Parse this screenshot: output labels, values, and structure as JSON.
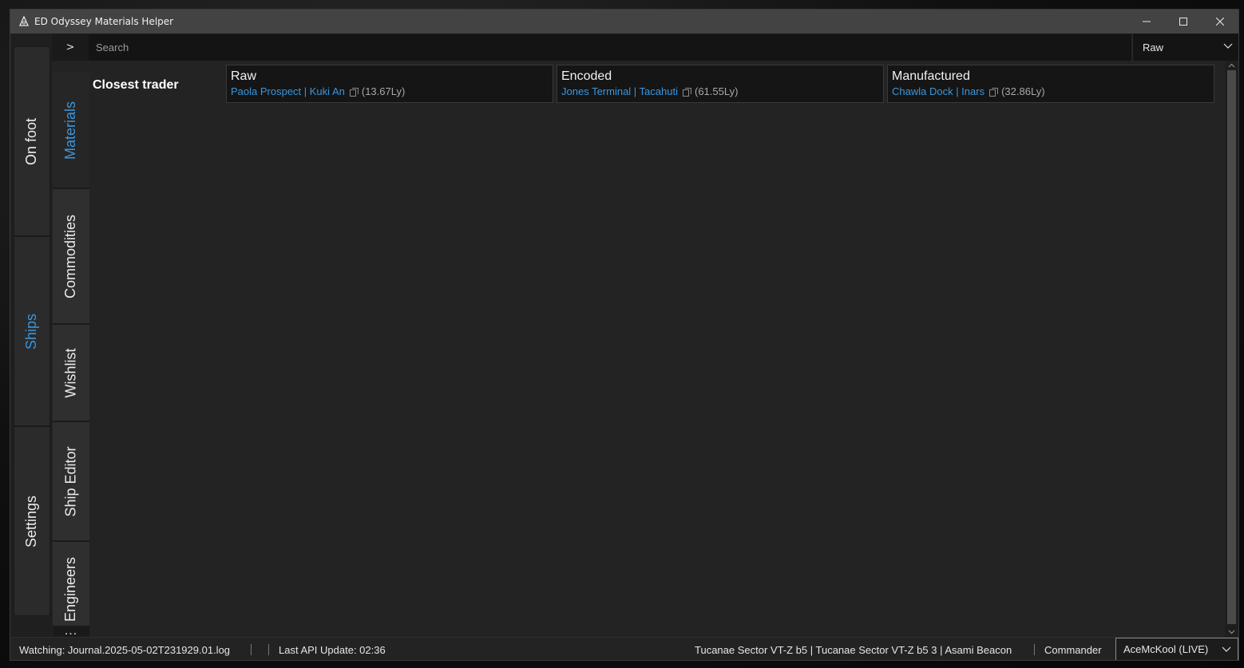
{
  "window": {
    "title": "ED Odyssey Materials Helper"
  },
  "main_tabs": [
    {
      "label": "On foot",
      "active": false
    },
    {
      "label": "Ships",
      "active": true
    },
    {
      "label": "Settings",
      "active": false
    }
  ],
  "sub_tabs": [
    {
      "label": "Materials",
      "active": true
    },
    {
      "label": "Commodities",
      "active": false
    },
    {
      "label": "Wishlist",
      "active": false
    },
    {
      "label": "Ship Editor",
      "active": false
    },
    {
      "label": "Engineers",
      "active": false
    }
  ],
  "toggle_label": ">",
  "more_label": "...",
  "search": {
    "placeholder": "Search"
  },
  "filter": {
    "selected": "Raw"
  },
  "closest_trader": {
    "label": "Closest trader",
    "cards": [
      {
        "category": "Raw",
        "location": "Paola Prospect | Kuki An",
        "distance": "(13.67Ly)"
      },
      {
        "category": "Encoded",
        "location": "Jones Terminal | Tacahuti",
        "distance": "(61.55Ly)"
      },
      {
        "category": "Manufactured",
        "location": "Chawla Dock | Inars",
        "distance": "(32.86Ly)"
      }
    ]
  },
  "status": {
    "watching": "Watching: Journal.2025-05-02T231929.01.log",
    "api_update": "Last API Update: 02:36",
    "location": "Tucanae Sector VT-Z b5 | Tucanae Sector VT-Z b5 3 | Asami Beacon",
    "commander_label": "Commander",
    "commander_value": "AceMcKool (LIVE)"
  },
  "colors": {
    "accent": "#3a96dd",
    "titlebar": "#434343",
    "background": "#232323"
  }
}
